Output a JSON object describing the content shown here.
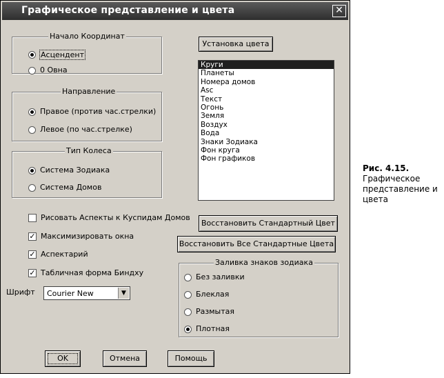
{
  "window": {
    "title": "Графическое представление и цвета",
    "close_label": "✕"
  },
  "origin_group": {
    "label": "Начало Координат",
    "options": [
      "Асцендент",
      "0 Овна"
    ],
    "selected": 0
  },
  "direction_group": {
    "label": "Направление",
    "options": [
      "Правое (против час.стрелки)",
      "Левое (по час.стрелке)"
    ],
    "selected": 0
  },
  "wheel_group": {
    "label": "Тип Колеса",
    "options": [
      "Система Зодиака",
      "Система Домов"
    ],
    "selected": 0
  },
  "checkboxes": [
    {
      "label": "Рисовать Аспекты к Куспидам Домов",
      "checked": false
    },
    {
      "label": "Максимизировать окна",
      "checked": true
    },
    {
      "label": "Аспектарий",
      "checked": true
    },
    {
      "label": "Табличная форма Биндху",
      "checked": true
    }
  ],
  "font": {
    "label": "Шрифт",
    "value": "Courier New"
  },
  "buttons": {
    "set_color": "Установка цвета",
    "restore_default": "Восстановить Стандартный Цвет",
    "restore_all": "Восстановить Все Стандартные Цвета",
    "ok": "OK",
    "cancel": "Отмена",
    "help": "Помощь"
  },
  "color_list": {
    "items": [
      "Круги",
      "Планеты",
      "Номера домов",
      "Asc",
      "Текст",
      "Огонь",
      "Земля",
      "Воздух",
      "Вода",
      "Знаки Зодиака",
      "Фон круга",
      "Фон графиков"
    ],
    "selected": 0
  },
  "fill_group": {
    "label": "Заливка знаков зодиака",
    "options": [
      "Без заливки",
      "Блеклая",
      "Размытая",
      "Плотная"
    ],
    "selected": 3
  },
  "caption": {
    "figure": "Рис. 4.15.",
    "text": "Графическое представление и цвета"
  },
  "colors": {
    "dialog_bg": "#d4d0c8",
    "titlebar": "#3c3c3c",
    "selection": "#1f1f1f"
  }
}
